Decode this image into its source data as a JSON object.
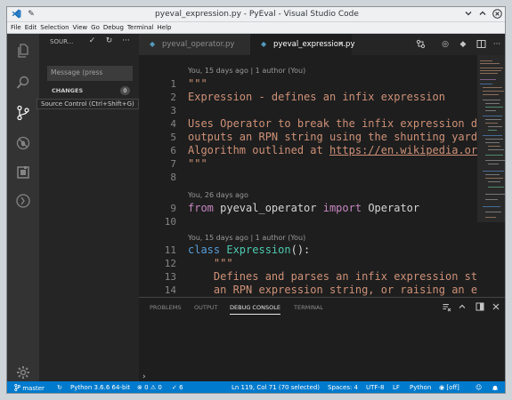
{
  "window": {
    "title": "pyeval_expression.py - PyEval - Visual Studio Code",
    "icon": "vscode-icon",
    "pin_icon": "pin-icon",
    "controls": [
      "chevron-down-icon",
      "chevron-up-icon",
      "close-icon"
    ]
  },
  "menu": [
    "File",
    "Edit",
    "Selection",
    "View",
    "Go",
    "Debug",
    "Terminal",
    "Help"
  ],
  "activity_bar": {
    "items": [
      "files-icon",
      "search-icon",
      "source-control-icon",
      "debug-icon",
      "extensions-icon",
      "remote-icon"
    ],
    "active": "source-control-icon",
    "settings": "gear-icon",
    "tooltip": "Source Control (Ctrl+Shift+G)"
  },
  "sidebar": {
    "title": "SOUR...",
    "commit_placeholder": "Message (press",
    "changes_label": "CHANGES",
    "changes_count": "0"
  },
  "tabs": [
    {
      "label": "pyeval_operator.py",
      "active": false
    },
    {
      "label": "pyeval_expression.py",
      "active": true,
      "close": "×"
    }
  ],
  "editor": {
    "lens1": "You, 15 days ago | 1 author (You)",
    "lens2": "You, 26 days ago",
    "lens3": "You, 15 days ago | 1 author (You)",
    "lines": {
      "l1": {
        "num": "1",
        "text": "\"\"\""
      },
      "l2": {
        "num": "2",
        "text": "Expression - defines an infix expression"
      },
      "l3": {
        "num": "3",
        "text": ""
      },
      "l4": {
        "num": "4",
        "text": "Uses Operator to break the infix expression do"
      },
      "l5": {
        "num": "5",
        "text": "outputs an RPN string using the shunting yard"
      },
      "l6": {
        "num": "6",
        "pre": "Algorithm outlined at ",
        "link": "https://en.wikipedia.org"
      },
      "l7": {
        "num": "7",
        "text": "\"\"\""
      },
      "l8": {
        "num": "8",
        "text": ""
      },
      "l9": {
        "num": "9",
        "from": "from",
        "module": " pyeval_operator ",
        "imp": "import",
        "name": " Operator"
      },
      "l10": {
        "num": "10",
        "text": ""
      },
      "l11": {
        "num": "11",
        "kw": "class",
        "name": " Expression",
        "rest": "():"
      },
      "l12": {
        "num": "12",
        "text": "    \"\"\""
      },
      "l13": {
        "num": "13",
        "text": "    Defines and parses an infix expression str"
      },
      "l14": {
        "num": "14",
        "text": "    an RPN expression string, or raising an ex"
      }
    }
  },
  "panel": {
    "tabs": [
      "PROBLEMS",
      "OUTPUT",
      "DEBUG CONSOLE",
      "TERMINAL"
    ],
    "active_tab": "DEBUG CONSOLE",
    "prompt": "›"
  },
  "status": {
    "branch": "master",
    "sync": "sync-icon",
    "python": "Python 3.6.6 64-bit",
    "errors": "0",
    "warnings": "0",
    "checks": "6",
    "position": "Ln 119, Col 71 (70 selected)",
    "spaces": "Spaces: 4",
    "encoding": "UTF-8",
    "eol": "LF",
    "language": "Python",
    "live": "[off]",
    "icons": [
      "smiley-icon",
      "bell-icon"
    ]
  },
  "colors": {
    "status_bar": "#007acc",
    "editor_bg": "#1e1e1e",
    "string": "#ce9178",
    "keyword": "#569cd6",
    "import_keyword": "#c586c0",
    "class_name": "#4ec9b0"
  }
}
